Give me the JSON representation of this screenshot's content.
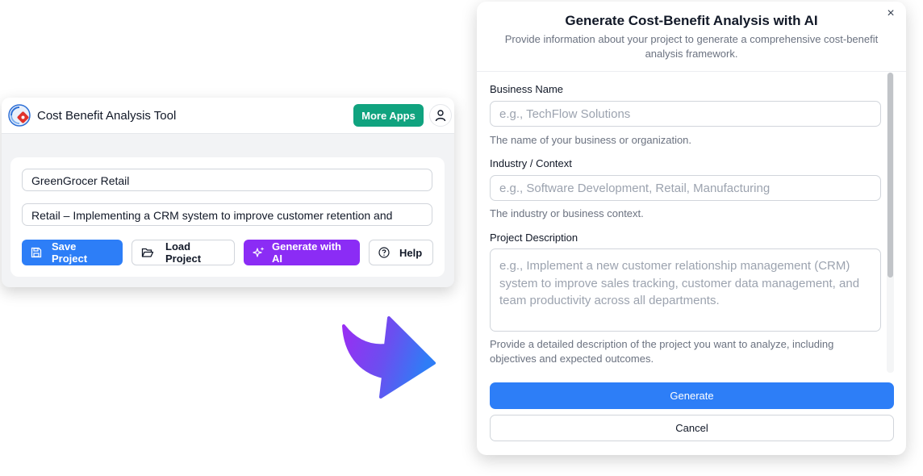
{
  "app": {
    "title": "Cost Benefit Analysis Tool",
    "more_apps_label": "More Apps",
    "business_name_value": "GreenGrocer Retail",
    "context_value": "Retail – Implementing a CRM system to improve customer retention and",
    "buttons": {
      "save": "Save Project",
      "load": "Load Project",
      "generate": "Generate with AI",
      "help": "Help"
    },
    "colors": {
      "more_apps": "#10a37f",
      "save": "#2d7ef7",
      "generate": "#8b2cf5"
    }
  },
  "modal": {
    "title": "Generate Cost-Benefit Analysis with AI",
    "subtitle": "Provide information about your project to generate a comprehensive cost-benefit analysis framework.",
    "close_icon": "×",
    "fields": {
      "business_name": {
        "label": "Business Name",
        "placeholder": "e.g., TechFlow Solutions",
        "help": "The name of your business or organization."
      },
      "industry": {
        "label": "Industry / Context",
        "placeholder": "e.g., Software Development, Retail, Manufacturing",
        "help": "The industry or business context."
      },
      "description": {
        "label": "Project Description",
        "placeholder": "e.g., Implement a new customer relationship management (CRM) system to improve sales tracking, customer data management, and team productivity across all departments.",
        "help": "Provide a detailed description of the project you want to analyze, including objectives and expected outcomes."
      }
    },
    "generate_label": "Generate",
    "cancel_label": "Cancel",
    "colors": {
      "generate": "#2d7ef7"
    }
  },
  "icons": {
    "logo": "app-logo-icon",
    "user": "user-icon",
    "save": "save-icon",
    "load": "folder-open-icon",
    "generate": "sparkles-icon",
    "help": "help-circle-icon",
    "arrow": "arrow-right-icon"
  }
}
